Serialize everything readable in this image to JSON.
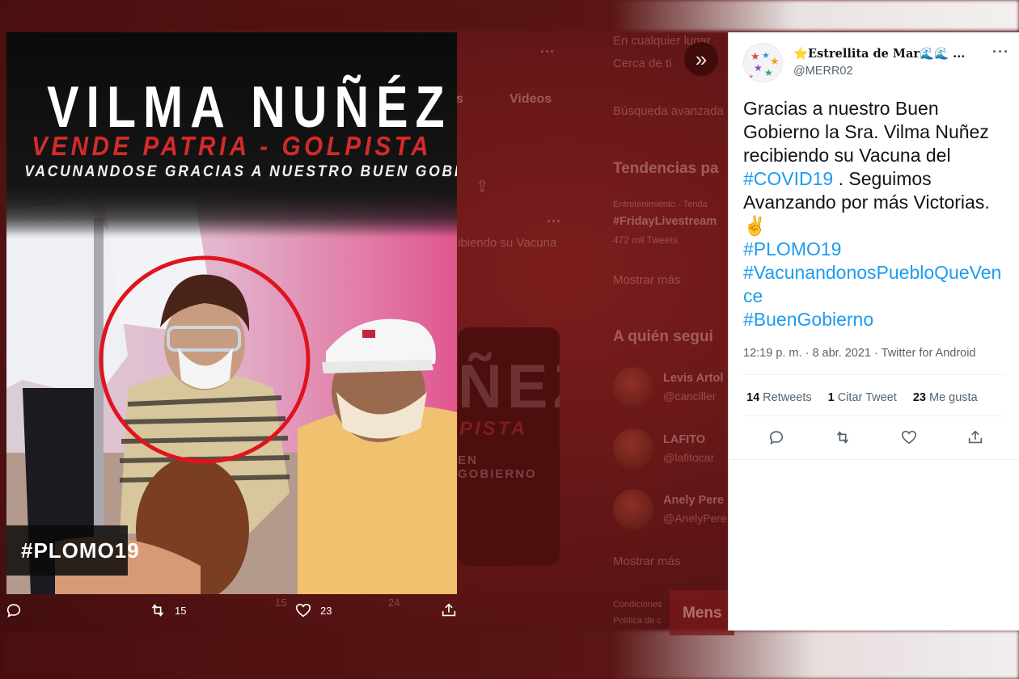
{
  "background": {
    "explore_links": [
      "En cualquier lugar",
      "Cerca de ti",
      "Búsqueda avanzada"
    ],
    "tabs": [
      "s",
      "Videos"
    ],
    "trends_title": "Tendencias pa",
    "trend_meta": "Entretenimiento · Tenda",
    "trend_tag": "#FridayLivestream",
    "trend_count": "472 mil Tweets",
    "show_more_1": "Mostrar más",
    "follow_title": "A quién segui",
    "follow_suggestions": [
      {
        "name": "Levis Artol",
        "handle": "@canciller"
      },
      {
        "name": "LAFITO",
        "handle": "@lafitocar"
      },
      {
        "name": "Anely Pere",
        "handle": "@AnelyPere"
      }
    ],
    "show_more_2": "Mostrar más",
    "background_snippet": "ibiendo su Vacuna",
    "footer_links": [
      "Condiciones",
      "Política de c"
    ],
    "messages_label": "Mens",
    "ghost_retweets": "15",
    "ghost_likes": "24",
    "ghost_poster_lines": [
      "ÑEZ",
      "PISTA",
      "EN GOBIERNO"
    ]
  },
  "media": {
    "poster_title": "VILMA NUÑÉZ",
    "poster_subtitle": "VENDE PATRIA - GOLPISTA",
    "poster_caption": "VACUNANDOSE GRACIAS A NUESTRO BUEN GOBIERNO",
    "poster_tag": "#PLOMO19",
    "actions": {
      "reply_count": "",
      "retweet_count": "15",
      "like_count": "23"
    }
  },
  "tweet": {
    "display_name": "⭐Estrellita de Mar🌊🌊 ...",
    "handle": "@MERR02",
    "text_lines": [
      {
        "text": "Gracias a nuestro Buen",
        "link": false
      },
      {
        "text": "Gobierno la Sra. Vilma Nuñez",
        "link": false
      },
      {
        "text": "recibiendo su Vacuna del",
        "link": false
      }
    ],
    "hashtag_covid": "#COVID19",
    "text_after_covid": " . Seguimos",
    "text_line_5": "Avanzando por más Victorias.",
    "emoji": "✌",
    "hashtags": [
      "#PLOMO19",
      "#VacunandonosPuebloQueVen",
      "ce",
      "#BuenGobierno"
    ],
    "time": "12:19 p. m.",
    "date": "8 abr. 2021",
    "source": "Twitter for Android",
    "meta_separator": " · ",
    "retweets_count": "14",
    "retweets_label": "Retweets",
    "quotes_count": "1",
    "quotes_label": "Citar Tweet",
    "likes_count": "23",
    "likes_label": "Me gusta"
  },
  "colors": {
    "link": "#1d9bf0",
    "text": "#0f1419",
    "secondary": "#536471",
    "poster_red": "#d42a2a",
    "tint": "#5c1414"
  }
}
